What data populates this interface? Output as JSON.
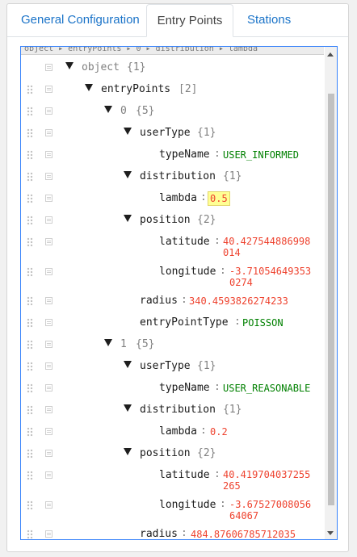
{
  "tabs": [
    {
      "label": "General Configuration",
      "active": false
    },
    {
      "label": "Entry Points",
      "active": true
    },
    {
      "label": "Stations",
      "active": false
    }
  ],
  "navbar": {
    "path": "object ▸ entryPoints ▸ 0 ▸ distribution ▸ lambda"
  },
  "tree": {
    "root": {
      "key": "object",
      "count": "{1}"
    },
    "entryPoints": {
      "key": "entryPoints",
      "count": "[2]"
    },
    "ep0": {
      "index": "0",
      "count": "{5}"
    },
    "ep0_userType": {
      "key": "userType",
      "count": "{1}"
    },
    "ep0_typeName": {
      "key": "typeName",
      "value": "USER_INFORMED"
    },
    "ep0_distribution": {
      "key": "distribution",
      "count": "{1}"
    },
    "ep0_lambda": {
      "key": "lambda",
      "value": "0.5"
    },
    "ep0_position": {
      "key": "position",
      "count": "{2}"
    },
    "ep0_latitude": {
      "key": "latitude",
      "value": "40.427544886998\n014"
    },
    "ep0_longitude": {
      "key": "longitude",
      "value": "-3.71054649353\n0274"
    },
    "ep0_radius": {
      "key": "radius",
      "value": "340.4593826274233"
    },
    "ep0_entryPointType": {
      "key": "entryPointType",
      "value": "POISSON"
    },
    "ep1": {
      "index": "1",
      "count": "{5}"
    },
    "ep1_userType": {
      "key": "userType",
      "count": "{1}"
    },
    "ep1_typeName": {
      "key": "typeName",
      "value": "USER_REASONABLE"
    },
    "ep1_distribution": {
      "key": "distribution",
      "count": "{1}"
    },
    "ep1_lambda": {
      "key": "lambda",
      "value": "0.2"
    },
    "ep1_position": {
      "key": "position",
      "count": "{2}"
    },
    "ep1_latitude": {
      "key": "latitude",
      "value": "40.419704037255\n265"
    },
    "ep1_longitude": {
      "key": "longitude",
      "value": "-3.67527008056\n64067"
    },
    "ep1_radius": {
      "key": "radius",
      "value": "484.87606785712035"
    }
  }
}
